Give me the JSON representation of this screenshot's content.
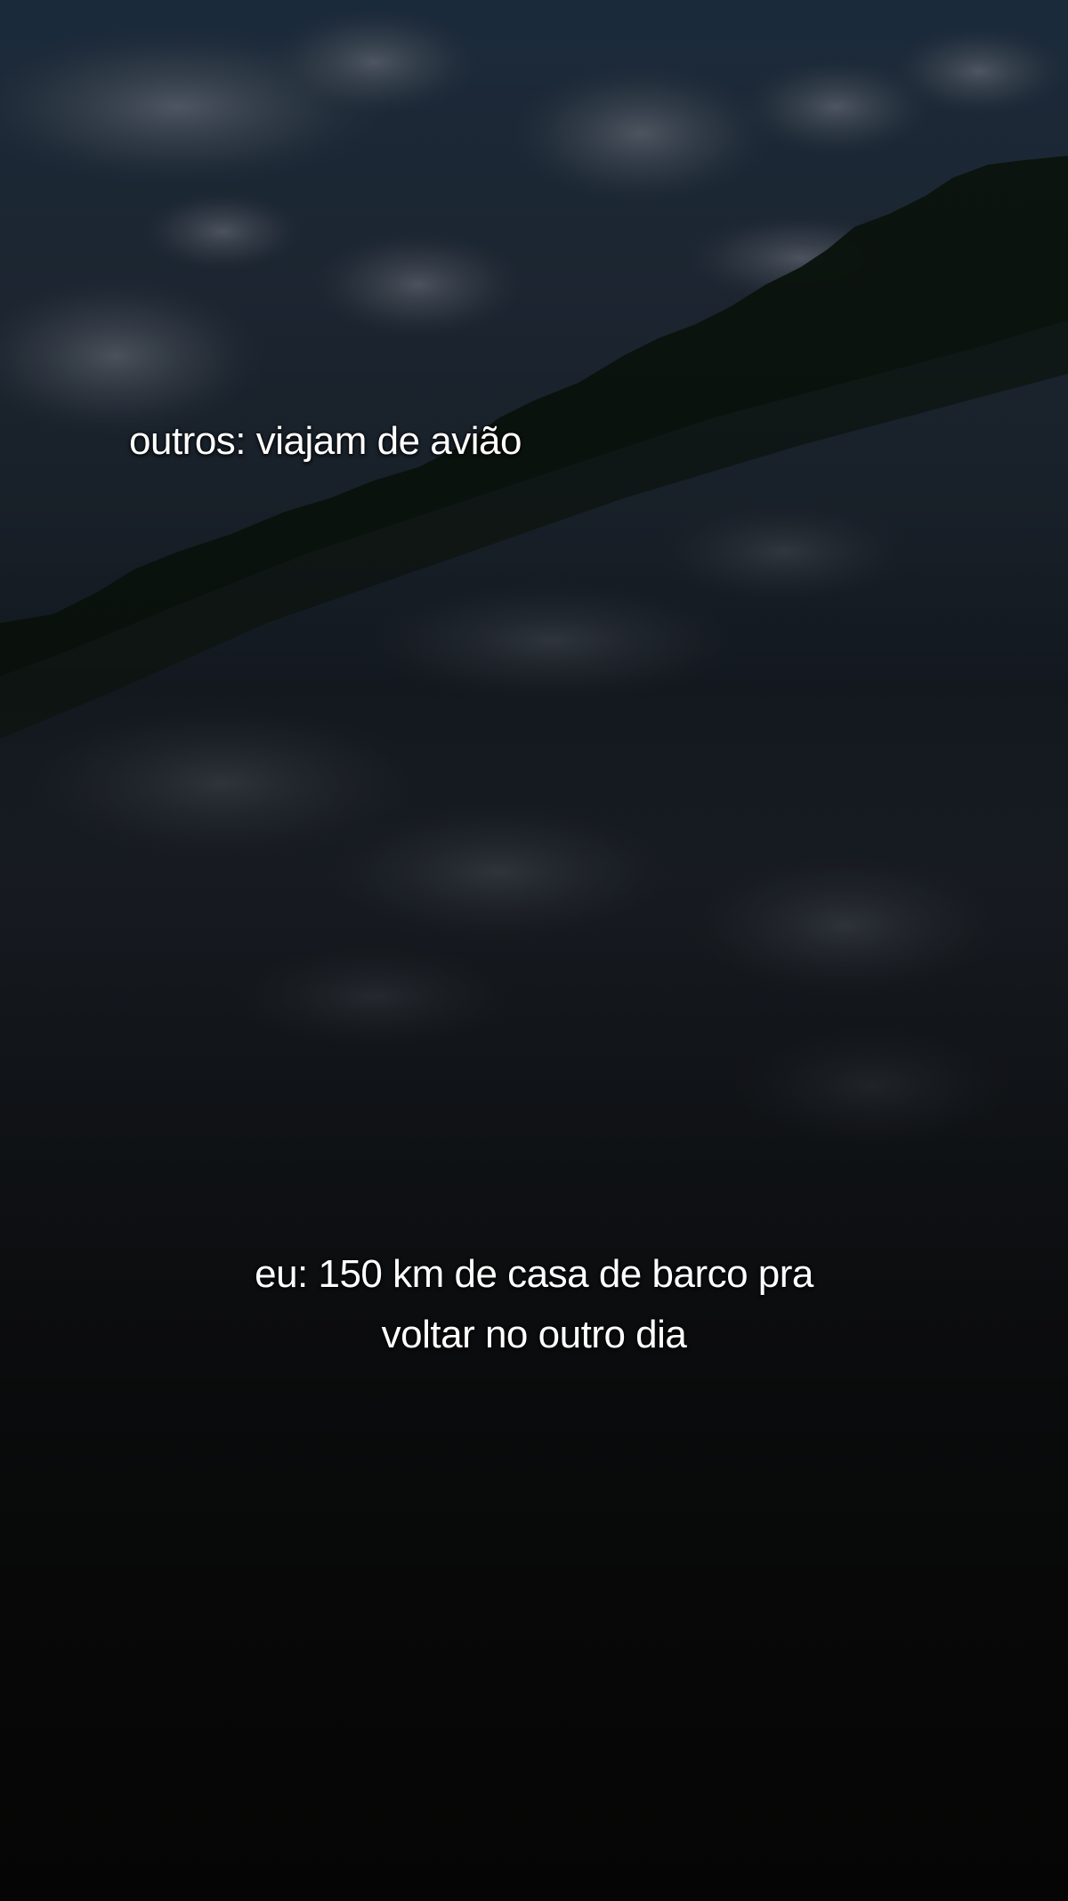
{
  "captions": {
    "top": "outros: viajam de avião",
    "bottom_line1": "eu: 150 km de casa de barco pra",
    "bottom_line2": "voltar no outro dia"
  },
  "scene": {
    "description_icon": "river-landscape-image",
    "colors": {
      "sky": "#1b2a3b",
      "treeline": "#0c140e",
      "water": "#14181d",
      "foreground": "#0b0b0a"
    }
  }
}
